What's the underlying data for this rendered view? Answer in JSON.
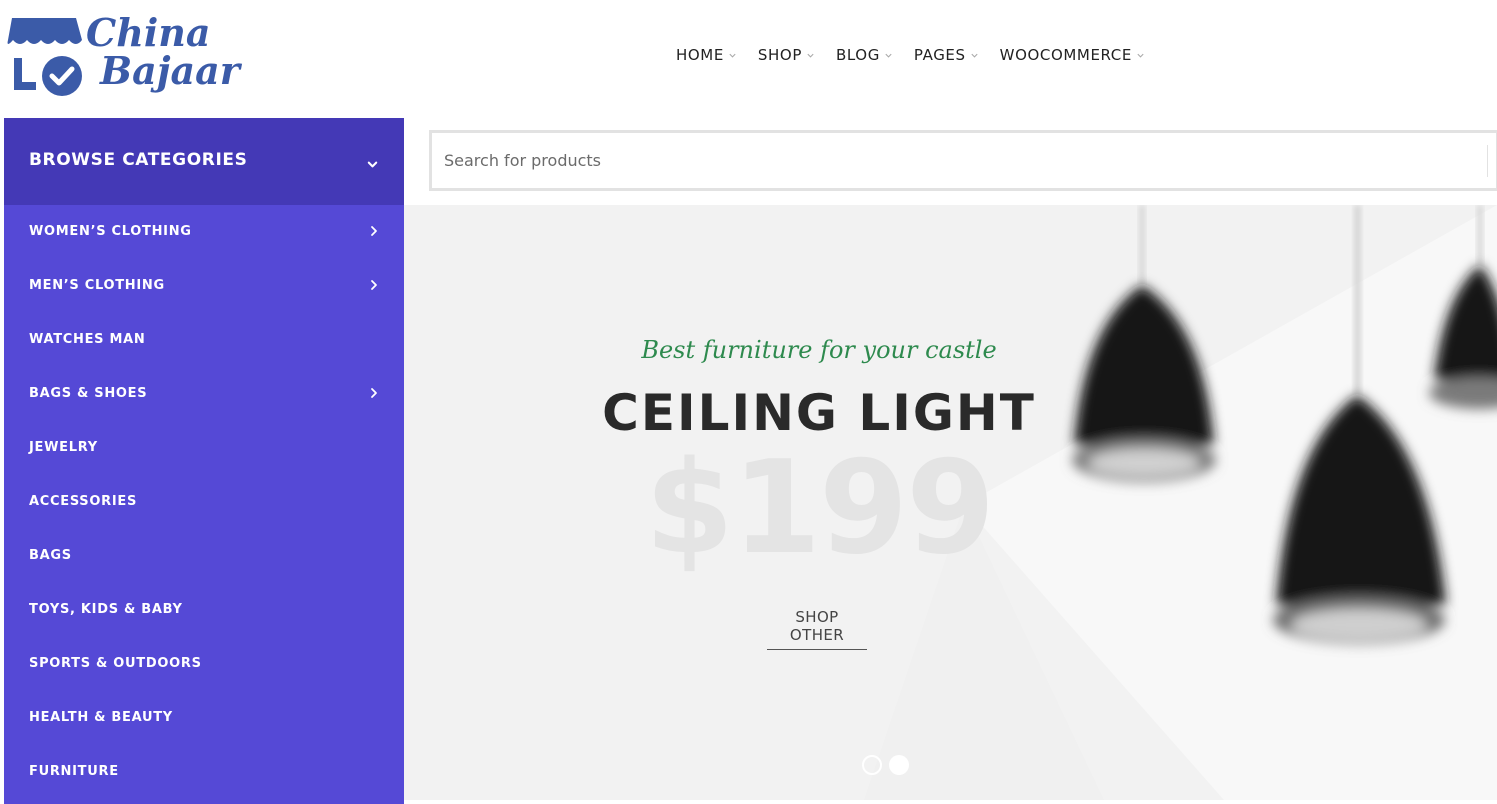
{
  "logo": {
    "line1": "China",
    "line2": "Bajaar",
    "color": "#3b5ba8"
  },
  "nav": {
    "items": [
      {
        "label": "HOME",
        "icon": "chevron-down-icon"
      },
      {
        "label": "SHOP",
        "icon": "chevron-down-icon"
      },
      {
        "label": "BLOG",
        "icon": "chevron-down-icon"
      },
      {
        "label": "PAGES",
        "icon": "chevron-down-icon"
      },
      {
        "label": "WOOCOMMERCE",
        "icon": "chevron-down-icon"
      }
    ]
  },
  "sidebar": {
    "title": "BROWSE CATEGORIES",
    "header_color": "#4439b6",
    "background_color": "#5549d6",
    "categories": [
      {
        "label": "WOMEN’S CLOTHING",
        "has_submenu": true
      },
      {
        "label": "MEN’S CLOTHING",
        "has_submenu": true
      },
      {
        "label": "WATCHES MAN",
        "has_submenu": false
      },
      {
        "label": "BAGS & SHOES",
        "has_submenu": true
      },
      {
        "label": "JEWELRY",
        "has_submenu": false
      },
      {
        "label": "ACCESSORIES",
        "has_submenu": false
      },
      {
        "label": "BAGS",
        "has_submenu": false
      },
      {
        "label": "TOYS, KIDS & BABY",
        "has_submenu": false
      },
      {
        "label": "SPORTS & OUTDOORS",
        "has_submenu": false
      },
      {
        "label": "HEALTH & BEAUTY",
        "has_submenu": false
      },
      {
        "label": "FURNITURE",
        "has_submenu": false
      }
    ]
  },
  "search": {
    "placeholder": "Search for products",
    "value": ""
  },
  "hero": {
    "tagline": "Best furniture for your castle",
    "title": "CEILING LIGHT",
    "price": "$199",
    "cta": "SHOP OTHER",
    "accent_color": "#2e8a4e",
    "slides": 2,
    "active_slide": 2
  }
}
